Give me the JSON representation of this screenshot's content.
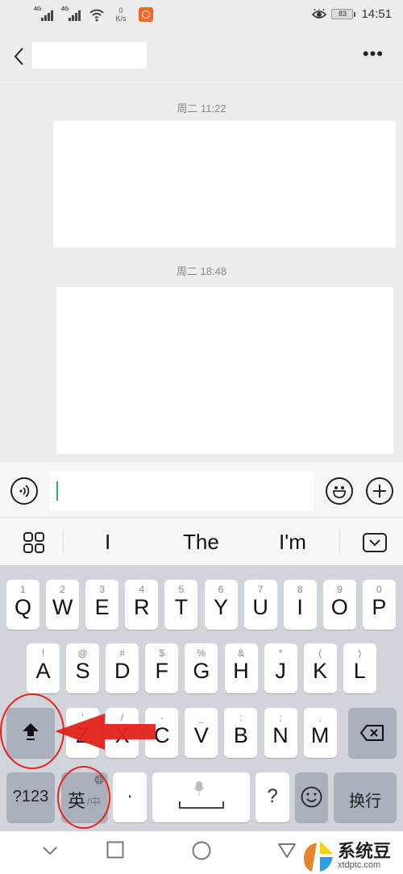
{
  "status_bar": {
    "signal1_label": "4G",
    "signal2_label": "4G",
    "net_speed_value": "0",
    "net_speed_unit": "K/s",
    "battery": "83",
    "time": "14:51",
    "icons": [
      "signal-icon",
      "signal-icon",
      "wifi-icon",
      "app-notification-icon",
      "eye-comfort-icon",
      "battery-icon"
    ]
  },
  "header": {
    "back_icon": "chevron-left-icon",
    "title": "",
    "more_icon": "more-dots-icon",
    "more_label": "•••"
  },
  "chat": {
    "messages": [
      {
        "time": "周二 11:22",
        "content": ""
      },
      {
        "time": "周二 18:48",
        "content": ""
      }
    ]
  },
  "input_bar": {
    "voice_icon": "voice-icon",
    "text_value": "",
    "emoji_icon": "emoji-icon",
    "plus_icon": "plus-icon"
  },
  "suggestions": {
    "menu_icon": "grid-icon",
    "words": [
      "I",
      "The",
      "I'm"
    ],
    "collapse_icon": "keyboard-hide-icon"
  },
  "keyboard": {
    "row1": [
      {
        "hint": "1",
        "key": "Q"
      },
      {
        "hint": "2",
        "key": "W"
      },
      {
        "hint": "3",
        "key": "E"
      },
      {
        "hint": "4",
        "key": "R"
      },
      {
        "hint": "5",
        "key": "T"
      },
      {
        "hint": "6",
        "key": "Y"
      },
      {
        "hint": "7",
        "key": "U"
      },
      {
        "hint": "8",
        "key": "I"
      },
      {
        "hint": "9",
        "key": "O"
      },
      {
        "hint": "0",
        "key": "P"
      }
    ],
    "row2": [
      {
        "hint": "!",
        "key": "A"
      },
      {
        "hint": "@",
        "key": "S"
      },
      {
        "hint": "#",
        "key": "D"
      },
      {
        "hint": "$",
        "key": "F"
      },
      {
        "hint": "%",
        "key": "G"
      },
      {
        "hint": "&",
        "key": "H"
      },
      {
        "hint": "*",
        "key": "J"
      },
      {
        "hint": "(",
        "key": "K"
      },
      {
        "hint": ")",
        "key": "L"
      }
    ],
    "row3": [
      {
        "hint": "'",
        "key": "Z"
      },
      {
        "hint": "/",
        "key": "X"
      },
      {
        "hint": "-",
        "key": "C"
      },
      {
        "hint": "_",
        "key": "V"
      },
      {
        "hint": ":",
        "key": "B"
      },
      {
        "hint": ";",
        "key": "N"
      },
      {
        "hint": ",",
        "key": "M"
      }
    ],
    "shift_icon": "shift-icon",
    "backspace_icon": "backspace-icon",
    "numbers_label": "?123",
    "lang_main": "英",
    "lang_alt": "/中",
    "globe_icon": "globe-icon",
    "period_label": "·",
    "space_icon": "mic-icon",
    "question_label": "?",
    "emoji_icon": "smiley-icon",
    "enter_label": "换行"
  },
  "nav_bar": {
    "icons": [
      "collapse-icon",
      "recents-icon",
      "home-icon",
      "back-icon"
    ]
  },
  "watermark": {
    "name": "系统豆",
    "url": "xtdptc.com"
  },
  "annotation": {
    "color": "#e2231a"
  }
}
